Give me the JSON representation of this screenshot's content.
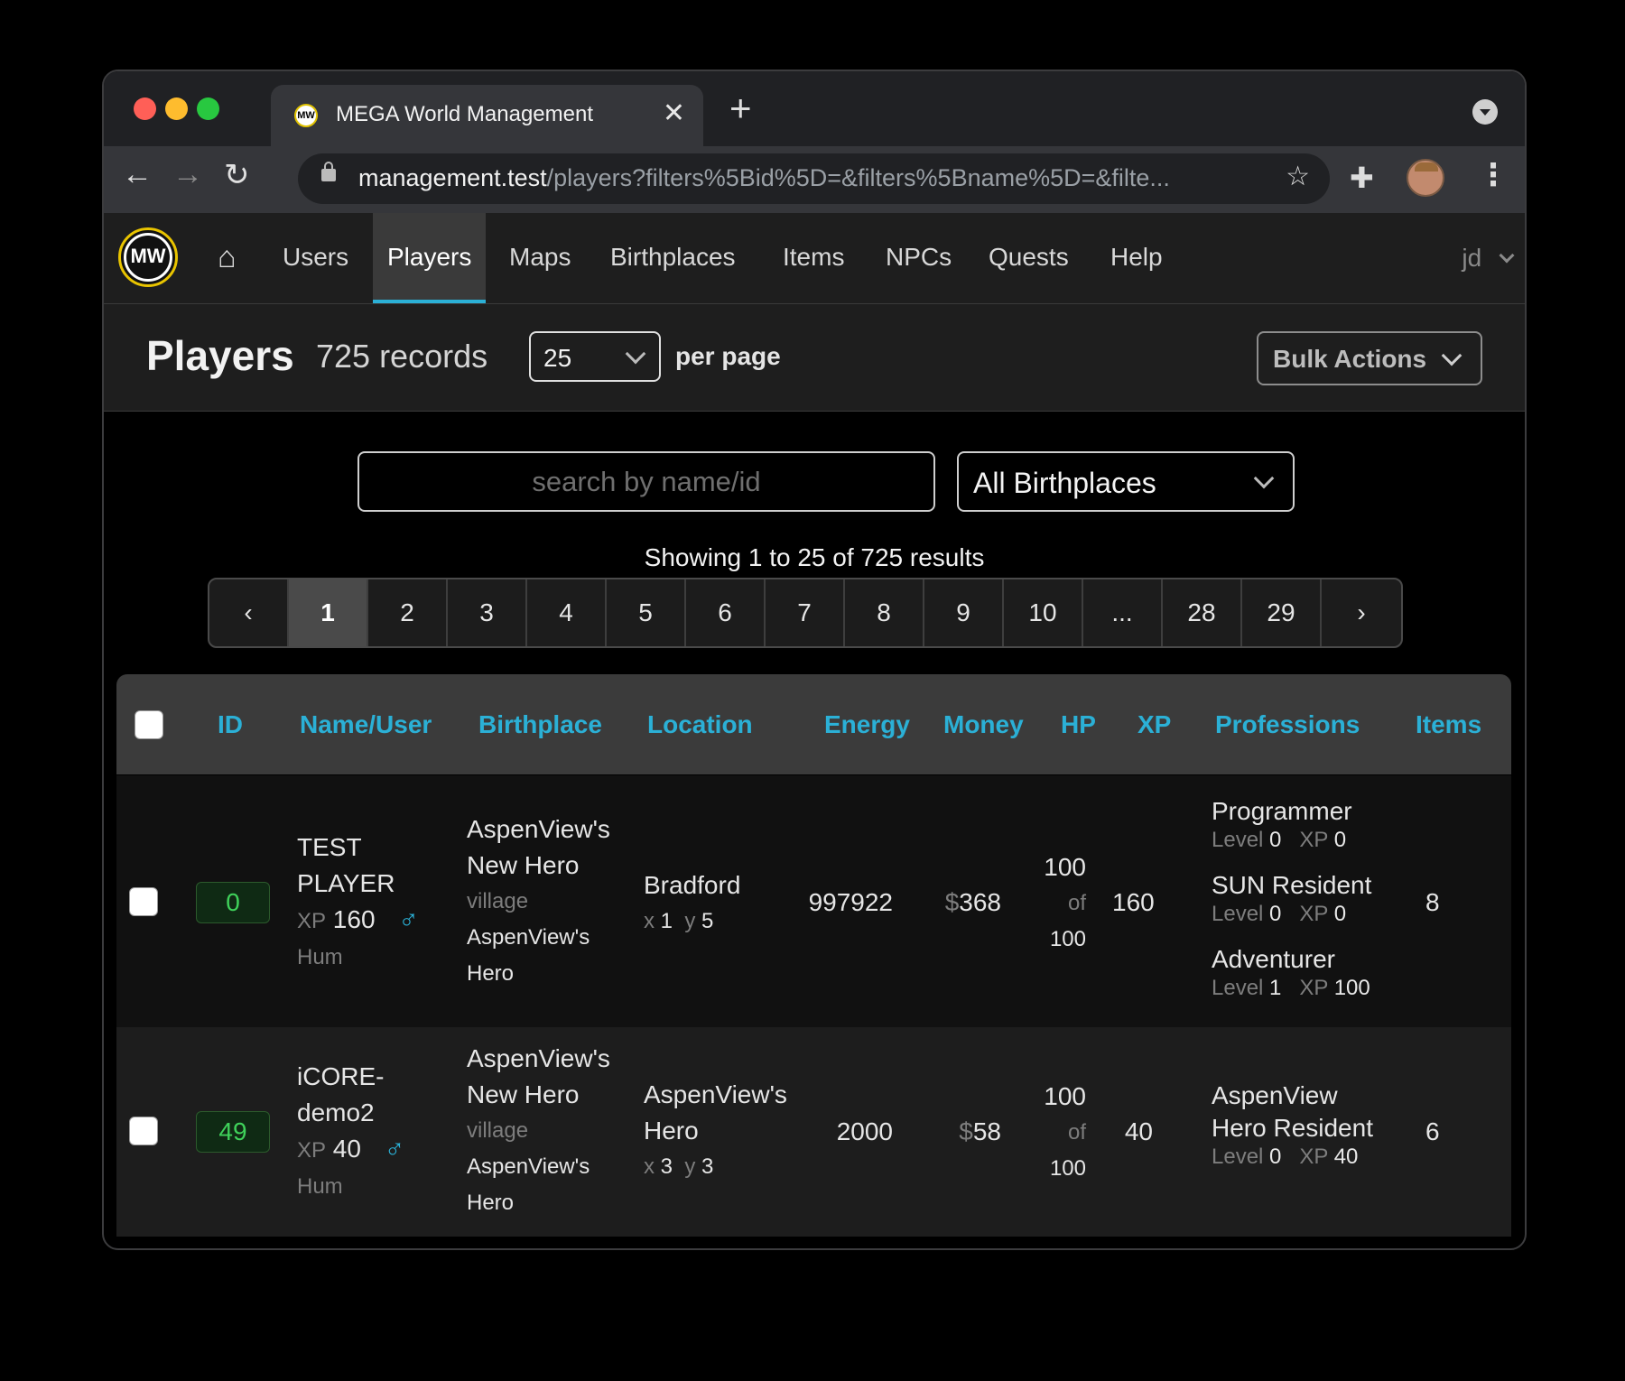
{
  "browser": {
    "tab_title": "MEGA World Management",
    "favicon": "MW",
    "url_host": "management.test",
    "url_path": "/players?filters%5Bid%5D=&filters%5Bname%5D=&filte..."
  },
  "nav": {
    "logo": "MW",
    "items": [
      {
        "label": "Users"
      },
      {
        "label": "Players"
      },
      {
        "label": "Maps"
      },
      {
        "label": "Birthplaces"
      },
      {
        "label": "Items"
      },
      {
        "label": "NPCs"
      },
      {
        "label": "Quests"
      },
      {
        "label": "Help"
      }
    ],
    "user": "jd"
  },
  "header": {
    "title": "Players",
    "records": "725 records",
    "per_page_value": "25",
    "per_page_label": "per page",
    "bulk_actions": "Bulk Actions"
  },
  "filters": {
    "search_placeholder": "search by name/id",
    "birthplace_value": "All Birthplaces"
  },
  "results": {
    "showing": "Showing 1 to 25 of 725 results",
    "pages": [
      "1",
      "2",
      "3",
      "4",
      "5",
      "6",
      "7",
      "8",
      "9",
      "10",
      "...",
      "28",
      "29"
    ],
    "current_page": "1"
  },
  "table": {
    "columns": [
      "ID",
      "Name/User",
      "Birthplace",
      "Location",
      "Energy",
      "Money",
      "HP",
      "XP",
      "Professions",
      "Items"
    ],
    "rows": [
      {
        "id": "0",
        "name_line1": "TEST",
        "name_line2": "PLAYER",
        "xp_label": "XP",
        "xp": "160",
        "race": "Hum",
        "birthplace_name1": "AspenView's",
        "birthplace_name2": "New Hero",
        "birthplace_type": "village",
        "birthplace_map1": "AspenView's",
        "birthplace_map2": "Hero",
        "location_line1": "Bradford",
        "location_line2": "",
        "x_label": "x",
        "x": "1",
        "y_label": "y",
        "y": "5",
        "energy": "997922",
        "money_sign": "$",
        "money": "368",
        "hp": "100",
        "hp_of": "of",
        "hp_max": "100",
        "xp_total": "160",
        "professions": [
          {
            "name1": "Programmer",
            "name2": "",
            "level": "0",
            "xp": "0"
          },
          {
            "name1": "SUN Resident",
            "name2": "",
            "level": "0",
            "xp": "0"
          },
          {
            "name1": "Adventurer",
            "name2": "",
            "level": "1",
            "xp": "100"
          }
        ],
        "items": "8"
      },
      {
        "id": "49",
        "name_line1": "iCORE-",
        "name_line2": "demo2",
        "xp_label": "XP",
        "xp": "40",
        "race": "Hum",
        "birthplace_name1": "AspenView's",
        "birthplace_name2": "New Hero",
        "birthplace_type": "village",
        "birthplace_map1": "AspenView's",
        "birthplace_map2": "Hero",
        "location_line1": "AspenView's",
        "location_line2": "Hero",
        "x_label": "x",
        "x": "3",
        "y_label": "y",
        "y": "3",
        "energy": "2000",
        "money_sign": "$",
        "money": "58",
        "hp": "100",
        "hp_of": "of",
        "hp_max": "100",
        "xp_total": "40",
        "professions": [
          {
            "name1": "AspenView",
            "name2": "Hero Resident",
            "level": "0",
            "xp": "40"
          }
        ],
        "items": "6"
      }
    ],
    "level_label": "Level",
    "prof_xp_label": "XP"
  },
  "colors": {
    "accent": "#2bb0d6",
    "id_badge": "#3fd15a",
    "background": "#000000"
  }
}
